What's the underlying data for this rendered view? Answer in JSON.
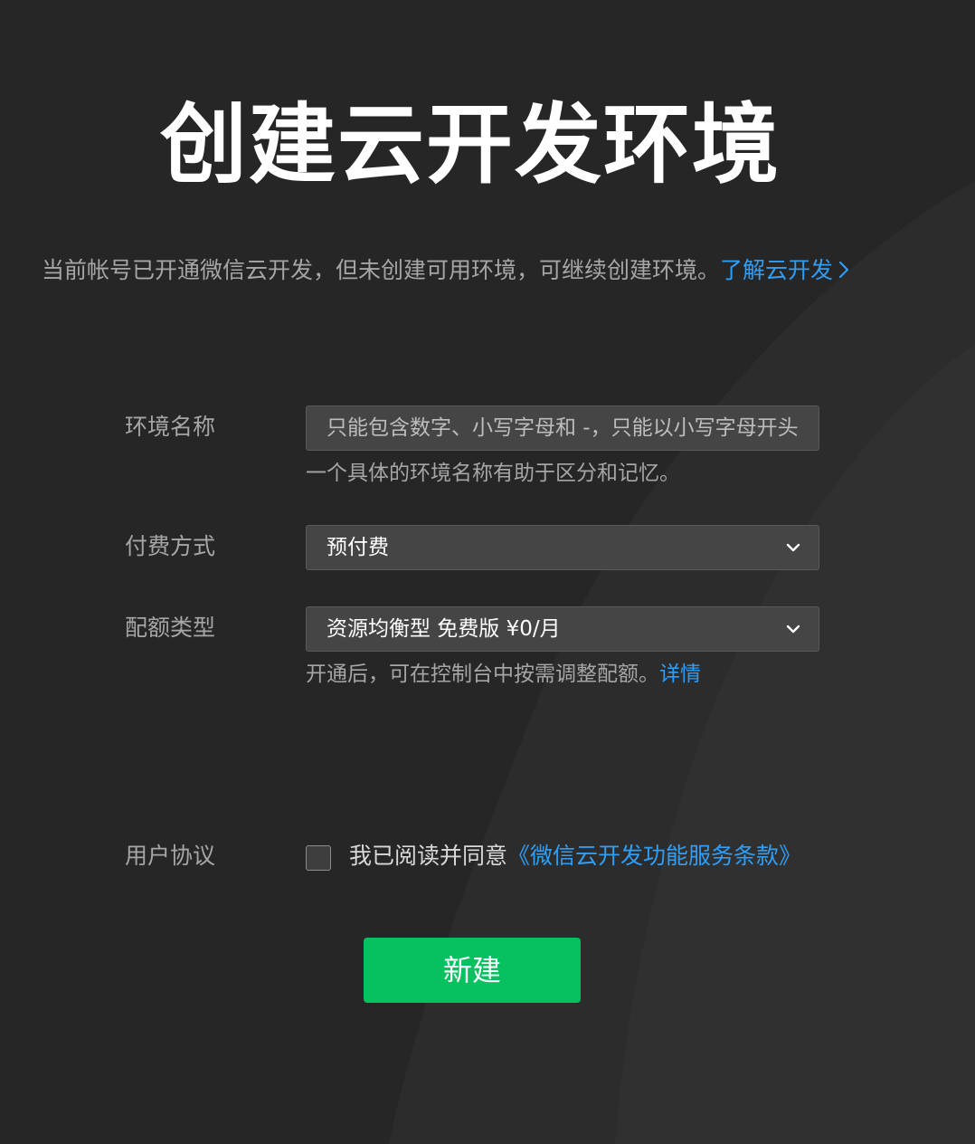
{
  "page": {
    "title": "创建云开发环境",
    "subtitle": "当前帐号已开通微信云开发，但未创建可用环境，可继续创建环境。",
    "learn_more_link": "了解云开发"
  },
  "form": {
    "env_name": {
      "label": "环境名称",
      "placeholder": "只能包含数字、小写字母和 -，只能以小写字母开头",
      "value": "",
      "hint": "一个具体的环境名称有助于区分和记忆。"
    },
    "payment": {
      "label": "付费方式",
      "value": "预付费"
    },
    "quota": {
      "label": "配额类型",
      "value": "资源均衡型 免费版 ¥0/月",
      "hint": "开通后，可在控制台中按需调整配额。",
      "details_link": "详情"
    },
    "agreement": {
      "label": "用户协议",
      "checked": false,
      "text": "我已阅读并同意",
      "link": "《微信云开发功能服务条款》"
    },
    "submit_label": "新建"
  },
  "icons": {
    "learn_more": "chevron-right-icon",
    "select": "chevron-down-icon"
  },
  "colors": {
    "background": "#262626",
    "link": "#2f9ef7",
    "primary_button": "#07c160"
  }
}
